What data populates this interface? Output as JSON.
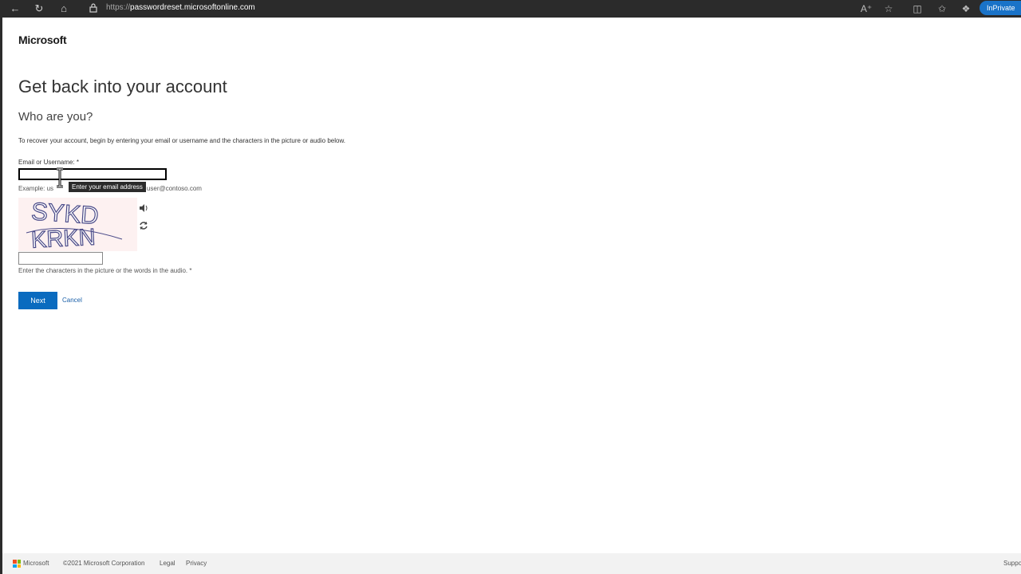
{
  "browser": {
    "url_prefix": "https://",
    "url_host": "passwordreset.microsoftonline.com",
    "inprivate_label": "InPrivate"
  },
  "page": {
    "brand": "Microsoft",
    "title": "Get back into your account",
    "subtitle": "Who are you?",
    "intro": "To recover your account, begin by entering your email or username and the characters in the picture or audio below.",
    "email_label": "Email or Username: *",
    "email_value": "",
    "example_text": "Example: us",
    "example_text_tail": "r user@contoso.com",
    "tooltip": "Enter your email address",
    "captcha_text_line1": "SYKD",
    "captcha_text_line2": "KRKN",
    "captcha_value": "",
    "captcha_help": "Enter the characters in the picture or the words in the audio. *",
    "next_label": "Next",
    "cancel_label": "Cancel"
  },
  "footer": {
    "brand": "Microsoft",
    "copyright": "©2021 Microsoft Corporation",
    "legal": "Legal",
    "privacy": "Privacy",
    "support": "Suppo"
  },
  "colors": {
    "accent": "#0a6bbf",
    "link": "#1a5fa8",
    "inprivate": "#1a73c8"
  }
}
